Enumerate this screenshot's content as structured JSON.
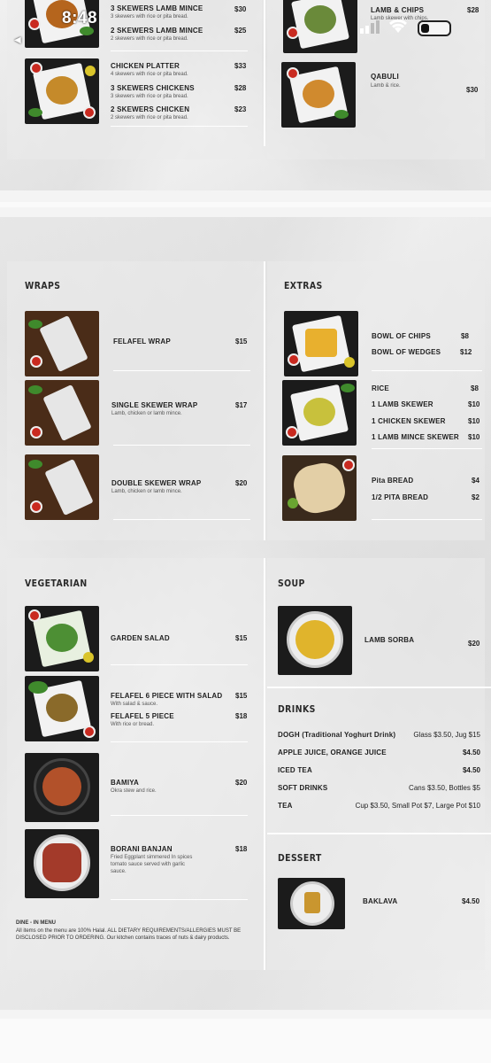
{
  "status_bar": {
    "time": "8:48",
    "back_label": "◀ "
  },
  "top_section": {
    "left_items": [
      {
        "name": "3 SKEWERS LAMB MINCE",
        "desc": "3 skewers with rice or pita bread.",
        "price": "$30"
      },
      {
        "name": "2 SKEWERS LAMB MINCE",
        "desc": "2 skewers with rice or pita bread.",
        "price": "$25"
      },
      {
        "name": "CHICKEN PLATTER",
        "desc": "4 skewers with rice or pita bread.",
        "price": "$33"
      },
      {
        "name": "3 SKEWERS CHICKENS",
        "desc": "3 skewers with rice or pita bread.",
        "price": "$28"
      },
      {
        "name": "2 SKEWERS CHICKEN",
        "desc": "2 skewers with rice or pita bread.",
        "price": "$23"
      }
    ],
    "right_items": [
      {
        "name": "LAMB & CHIPS",
        "desc": "Lamb skewer with chips.",
        "price": "$28"
      },
      {
        "name": "QABULI",
        "desc": "Lamb & rice.",
        "price": "$30"
      }
    ]
  },
  "wraps": {
    "title": "WRAPS",
    "items": [
      {
        "name": "FELAFEL WRAP",
        "desc": "",
        "price": "$15"
      },
      {
        "name": "SINGLE SKEWER WRAP",
        "desc": "Lamb, chicken or lamb mince.",
        "price": "$17"
      },
      {
        "name": "DOUBLE SKEWER WRAP",
        "desc": "Lamb, chicken or lamb mince.",
        "price": "$20"
      }
    ]
  },
  "extras": {
    "title": "EXTRAS",
    "items": [
      {
        "name": "BOWL OF CHIPS",
        "price": "$8"
      },
      {
        "name": "BOWL OF WEDGES",
        "price": "$12"
      },
      {
        "name": "RICE",
        "price": "$8"
      },
      {
        "name": "1 LAMB SKEWER",
        "price": "$10"
      },
      {
        "name": "1 CHICKEN SKEWER",
        "price": "$10"
      },
      {
        "name": "1 LAMB MINCE SKEWER",
        "price": "$10"
      },
      {
        "name": "Pita BREAD",
        "price": "$4"
      },
      {
        "name": "1/2 PITA BREAD",
        "price": "$2"
      }
    ]
  },
  "vegetarian": {
    "title": "VEGETARIAN",
    "items": [
      {
        "name": "GARDEN SALAD",
        "desc": "",
        "price": "$15"
      },
      {
        "name": "FELAFEL 6 PIECE WITH SALAD",
        "desc": "With salad & sauce.",
        "price": "$15"
      },
      {
        "name": "FELAFEL 5 PIECE",
        "desc": "With rice or bread.",
        "price": "$18"
      },
      {
        "name": "BAMIYA",
        "desc": "Okra stew and rice.",
        "price": "$20"
      },
      {
        "name": "BORANI BANJAN",
        "desc": "Fried Eggplant simmered In spices tomato sauce served with garlic sauce.",
        "price": "$18"
      }
    ],
    "note_title": "DINE - IN MENU",
    "note_text": "All items on the menu are 100% Halal. ALL DIETARY REQUIREMENTS/ALLERGIES MUST BE DISCLOSED PRIOR TO ORDERING. Our kitchen contains traces of nuts & dairy products."
  },
  "soup": {
    "title": "SOUP",
    "items": [
      {
        "name": "LAMB SORBA",
        "price": "$20"
      }
    ]
  },
  "drinks": {
    "title": "DRINKS",
    "items": [
      {
        "name": "DOGH (Traditional Yoghurt Drink)",
        "price": "Glass $3.50, Jug $15"
      },
      {
        "name": "APPLE JUICE, ORANGE JUICE",
        "price": "$4.50"
      },
      {
        "name": "ICED TEA",
        "price": "$4.50"
      },
      {
        "name": "SOFT DRINKS",
        "price": "Cans $3.50, Bottles $5"
      },
      {
        "name": "TEA",
        "price": "Cup $3.50, Small Pot $7, Large Pot $10"
      }
    ]
  },
  "dessert": {
    "title": "DESSERT",
    "items": [
      {
        "name": "BAKLAVA",
        "price": "$4.50"
      }
    ]
  },
  "colors": {
    "background": "#f4f4f4",
    "panel": "#e9e9e9",
    "text": "#1f1f1f"
  }
}
